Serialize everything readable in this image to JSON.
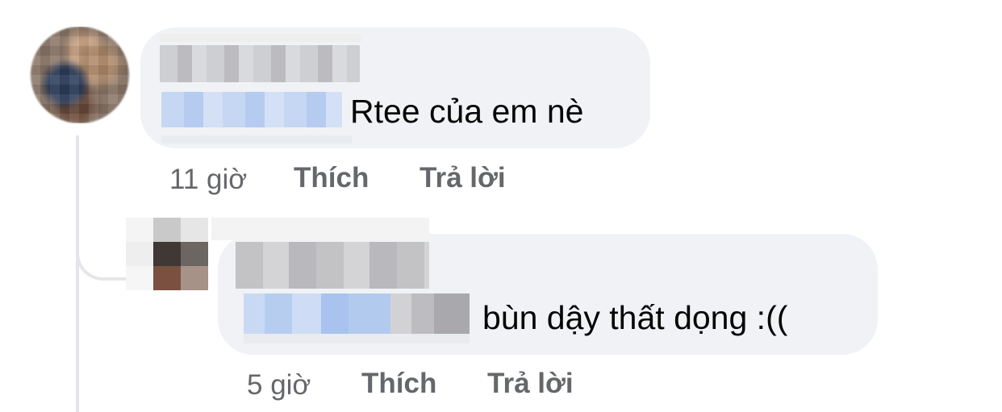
{
  "comments": [
    {
      "author_name": "",
      "mention": "",
      "text": "Rtee của em nè",
      "time": "11 giờ",
      "like_label": "Thích",
      "reply_label": "Trả lời"
    },
    {
      "author_name": "",
      "mention": "",
      "text": "bùn dậy thất dọng :((",
      "time": "5 giờ",
      "like_label": "Thích",
      "reply_label": "Trả lời"
    }
  ],
  "colors": {
    "bubble": "#f0f2f5",
    "meta_text": "#65676b",
    "comment_text": "#050505",
    "thread_line": "#e4e6eb",
    "mention_blur": "#b5cbef"
  }
}
